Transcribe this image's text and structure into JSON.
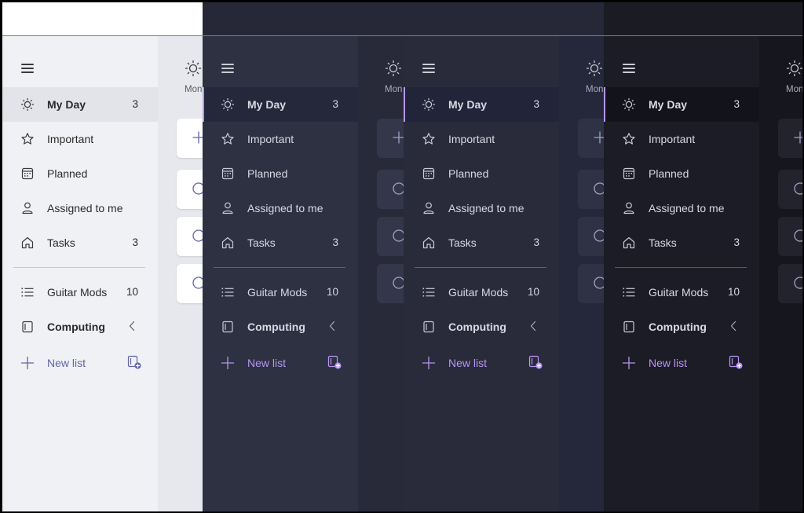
{
  "nav": {
    "my_day": {
      "label": "My Day",
      "count": "3"
    },
    "important": {
      "label": "Important"
    },
    "planned": {
      "label": "Planned"
    },
    "assigned": {
      "label": "Assigned to me"
    },
    "tasks": {
      "label": "Tasks",
      "count": "3"
    }
  },
  "lists": {
    "guitar": {
      "label": "Guitar Mods",
      "count": "10"
    },
    "computing": {
      "label": "Computing"
    },
    "new_list": {
      "label": "New list"
    }
  },
  "main": {
    "day_label": "Mon"
  },
  "themes": [
    {
      "name": "light",
      "titlebar": "#ffffff",
      "sidebar": "#f0f1f4",
      "main": "#e6e8ee",
      "text": "#2b2b2b",
      "muted": "#5c5c5c",
      "icon": "#3a3a3a",
      "active_bg": "#e3e4ea",
      "accent": "#6264a7",
      "divider": "#c8c9cf",
      "card": "#ffffff",
      "card_icon": "#6264a7"
    },
    {
      "name": "dark",
      "titlebar": "#262837",
      "sidebar": "#2d3142",
      "main": "#282a39",
      "text": "#d8d9e3",
      "muted": "#a9abb8",
      "icon": "#c9cad4",
      "active_bg": "#25283a",
      "accent": "#b696ee",
      "divider": "#5e6172",
      "card": "#34374a",
      "card_icon": "#9ea2c8"
    },
    {
      "name": "dark-blue",
      "titlebar": "#262838",
      "sidebar": "#292b3b",
      "main": "#25273a",
      "text": "#d8d9e3",
      "muted": "#a9abb8",
      "icon": "#c9cad4",
      "active_bg": "#22243a",
      "accent": "#b696ee",
      "divider": "#5e6172",
      "card": "#2f3244",
      "card_icon": "#9ea2c8"
    },
    {
      "name": "black",
      "titlebar": "#1b1b24",
      "sidebar": "#1c1c26",
      "main": "#16161f",
      "text": "#d8d9e3",
      "muted": "#a9abb8",
      "icon": "#c9cad4",
      "active_bg": "#13131c",
      "accent": "#b696ee",
      "divider": "#55586a",
      "card": "#23232e",
      "card_icon": "#9ea2c8"
    }
  ]
}
